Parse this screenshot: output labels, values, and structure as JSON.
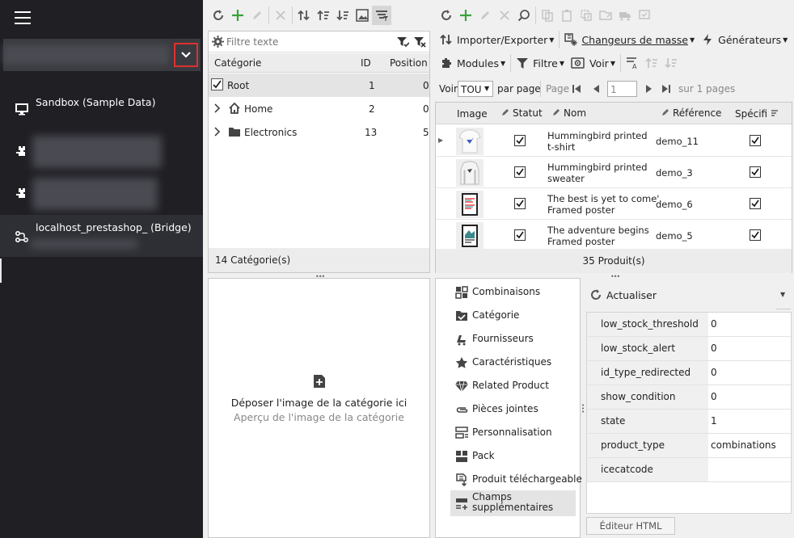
{
  "sidebar": {
    "connections": [
      {
        "label": "Sandbox (Sample Data)",
        "icon": "monitor-icon"
      },
      {
        "label": "",
        "icon": "plugin-icon"
      },
      {
        "label": "",
        "icon": "plugin-icon"
      },
      {
        "label": "localhost_prestashop_ (Bridge)",
        "icon": "bridge-icon"
      }
    ]
  },
  "categories": {
    "filter_placeholder": "Filtre texte",
    "columns": {
      "category": "Catégorie",
      "id": "ID",
      "position": "Position"
    },
    "rows": [
      {
        "name": "Root",
        "id": "1",
        "position": "0"
      },
      {
        "name": "Home",
        "id": "2",
        "position": "0"
      },
      {
        "name": "Electronics",
        "id": "13",
        "position": "5"
      }
    ],
    "footer": "14 Catégorie(s)"
  },
  "category_image": {
    "drop_text": "Déposer l'image de la catégorie ici",
    "preview_text": "Aperçu de l'image de la catégorie"
  },
  "products": {
    "toolbar": {
      "import_export": "Importer/Exporter",
      "bulk_changers": "Changeurs de masse",
      "generators": "Générateurs",
      "modules": "Modules",
      "filter": "Filtre",
      "view": "Voir"
    },
    "pager": {
      "show_label": "Voir",
      "show_value": "TOU",
      "per_page": "par page",
      "page_label": "Page",
      "page_value": "1",
      "of_pages": "sur 1 pages"
    },
    "columns": {
      "image": "Image",
      "status": "Statut",
      "name": "Nom",
      "reference": "Référence",
      "specific": "Spécifi"
    },
    "rows": [
      {
        "name_line1": "Hummingbird printed",
        "name_line2": "t-shirt",
        "reference": "demo_11",
        "thumb": "tshirt"
      },
      {
        "name_line1": "Hummingbird printed",
        "name_line2": "sweater",
        "reference": "demo_3",
        "thumb": "sweater"
      },
      {
        "name_line1": "The best is yet to come'",
        "name_line2": "Framed poster",
        "reference": "demo_6",
        "thumb": "poster"
      },
      {
        "name_line1": "The adventure begins",
        "name_line2": "Framed poster",
        "reference": "demo_5",
        "thumb": "poster2"
      }
    ],
    "footer": "35 Produit(s)"
  },
  "detail_menu": [
    {
      "label": "Combinaisons",
      "icon": "grid-icon"
    },
    {
      "label": "Catégorie",
      "icon": "folder-check-icon"
    },
    {
      "label": "Fournisseurs",
      "icon": "truck-icon"
    },
    {
      "label": "Caractéristiques",
      "icon": "star-icon"
    },
    {
      "label": "Related Product",
      "icon": "diamond-icon"
    },
    {
      "label": "Pièces jointes",
      "icon": "paperclip-icon"
    },
    {
      "label": "Personnalisation",
      "icon": "form-icon"
    },
    {
      "label": "Pack",
      "icon": "pack-icon"
    },
    {
      "label": "Produit téléchargeable",
      "icon": "download-icon"
    },
    {
      "label_line1": "Champs",
      "label_line2": "supplémentaires",
      "icon": "fields-icon"
    }
  ],
  "properties": {
    "refresh_label": "Actualiser",
    "rows": [
      {
        "key": "low_stock_threshold",
        "value": "0"
      },
      {
        "key": "low_stock_alert",
        "value": "0"
      },
      {
        "key": "id_type_redirected",
        "value": "0"
      },
      {
        "key": "show_condition",
        "value": "0"
      },
      {
        "key": "state",
        "value": "1"
      },
      {
        "key": "product_type",
        "value": "combinations"
      },
      {
        "key": "icecatcode",
        "value": ""
      }
    ],
    "html_editor_label": "Éditeur HTML"
  }
}
